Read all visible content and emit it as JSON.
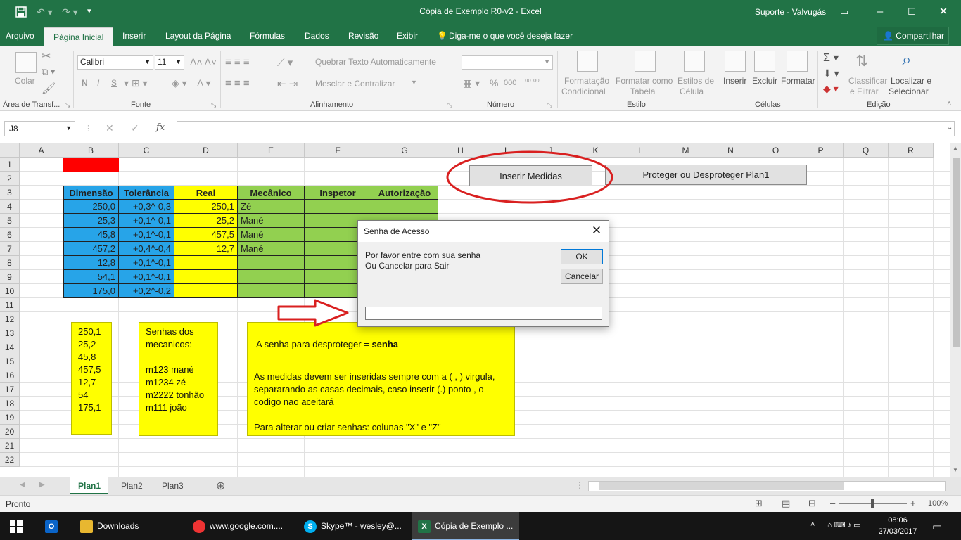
{
  "window": {
    "title": "Cópia de Exemplo R0-v2  -  Excel",
    "user": "Suporte - Valvugás"
  },
  "menu": {
    "file": "Arquivo",
    "tabs": [
      "Página Inicial",
      "Inserir",
      "Layout da Página",
      "Fórmulas",
      "Dados",
      "Revisão",
      "Exibir"
    ],
    "tell_me": "Diga-me o que você deseja fazer",
    "share": "Compartilhar"
  },
  "ribbon": {
    "clipboard": {
      "paste": "Colar",
      "group": "Área de Transf..."
    },
    "font": {
      "name": "Calibri",
      "size": "11",
      "bold": "N",
      "italic": "I",
      "underline": "S",
      "group": "Fonte"
    },
    "alignment": {
      "wrap": "Quebrar Texto Automaticamente",
      "merge": "Mesclar e Centralizar",
      "group": "Alinhamento"
    },
    "number": {
      "group": "Número",
      "percent": "%",
      "thousands": "000"
    },
    "styles": {
      "conditional": [
        "Formatação",
        "Condicional"
      ],
      "table": [
        "Formatar como",
        "Tabela"
      ],
      "cell": [
        "Estilos de",
        "Célula"
      ],
      "group": "Estilo"
    },
    "cells": {
      "insert": "Inserir",
      "delete": "Excluir",
      "format": "Formatar",
      "group": "Células"
    },
    "editing": {
      "sort": [
        "Classificar",
        "e Filtrar"
      ],
      "find": [
        "Localizar e",
        "Selecionar"
      ],
      "group": "Edição"
    }
  },
  "formula_bar": {
    "name_box": "J8",
    "fx": "fx"
  },
  "sheet": {
    "columns": [
      "A",
      "B",
      "C",
      "D",
      "E",
      "F",
      "G",
      "H",
      "I",
      "J",
      "K",
      "L",
      "M",
      "N",
      "O",
      "P",
      "Q",
      "R"
    ],
    "rows": [
      "1",
      "2",
      "3",
      "4",
      "5",
      "6",
      "7",
      "8",
      "9",
      "10",
      "11",
      "12",
      "13",
      "14",
      "15",
      "16",
      "17",
      "18",
      "19",
      "20",
      "21",
      "22"
    ],
    "headers": [
      "Dimensão",
      "Tolerância",
      "Real",
      "Mecânico",
      "Inspetor",
      "Autorização"
    ],
    "data": [
      [
        "250,0",
        "+0,3^-0,3",
        "250,1",
        "Zé"
      ],
      [
        "25,3",
        "+0,1^-0,1",
        "25,2",
        "Mané"
      ],
      [
        "45,8",
        "+0,1^-0,1",
        "457,5",
        "Mané"
      ],
      [
        "457,2",
        "+0,4^-0,4",
        "12,7",
        "Mané"
      ],
      [
        "12,8",
        "+0,1^-0,1",
        "",
        ""
      ],
      [
        "54,1",
        "+0,1^-0,1",
        "",
        ""
      ],
      [
        "175,0",
        "+0,2^-0,2",
        "",
        ""
      ]
    ],
    "buttons": {
      "insert": "Inserir Medidas",
      "protect": "Proteger ou  Desproteger Plan1"
    },
    "note_values": "250,1\n25,2\n45,8\n457,5\n12,7\n54\n175,1",
    "note_passwords": "Senhas dos\nmecanicos:\n\nm123 mané\nm1234 zé\nm2222 tonhão\nm111 joão",
    "note_info": {
      "line1_prefix": "A senha para desproteger = ",
      "line1_bold": "senha",
      "body": "As medidas devem ser inseridas sempre  com a ( , ) virgula, separarando  as casas decimais, caso inserir (.) ponto , o codigo nao aceitará\n\nPara alterar ou criar  senhas:   colunas  \"X\" e \"Z\""
    }
  },
  "dialog": {
    "title": "Senha de Acesso",
    "message_line1": "Por favor entre com sua senha",
    "message_line2": "Ou Cancelar para Sair",
    "ok": "OK",
    "cancel": "Cancelar",
    "input_value": ""
  },
  "sheet_tabs": [
    "Plan1",
    "Plan2",
    "Plan3"
  ],
  "status": {
    "ready": "Pronto",
    "zoom": "100%"
  },
  "taskbar": {
    "items": [
      "Downloads",
      "www.google.com....",
      "Skype™ - wesley@...",
      "Cópia de Exemplo ..."
    ],
    "time": "08:06",
    "date": "27/03/2017"
  },
  "colors": {
    "excel_green": "#217346",
    "blue_cells": "#27a4e8",
    "yellow_cells": "#ffff00",
    "green_cells": "#92d050",
    "annotation_red": "#d92020"
  }
}
